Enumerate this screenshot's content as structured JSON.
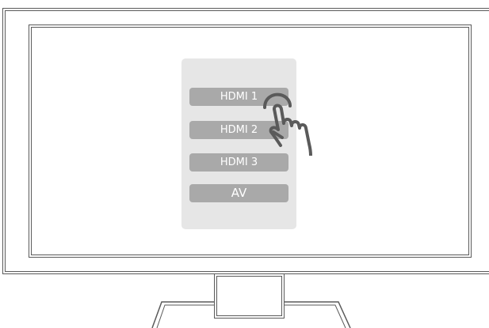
{
  "input_menu": {
    "options": [
      {
        "label": "HDMI 1"
      },
      {
        "label": "HDMI 2"
      },
      {
        "label": "HDMI 3"
      },
      {
        "label": "AV"
      }
    ]
  },
  "icons": {
    "pointer": "hand-tap-icon"
  },
  "colors": {
    "menu_background": "#e6e6e6",
    "option_background": "#a9a9a9",
    "option_text": "#ffffff",
    "outline": "#5a5a5a"
  }
}
